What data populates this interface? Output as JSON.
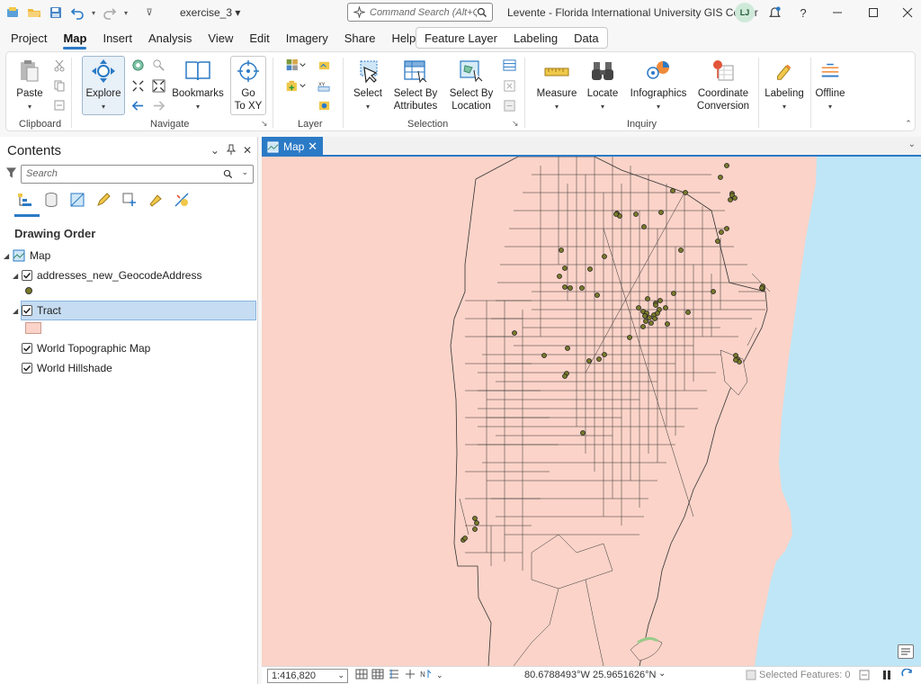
{
  "titlebar": {
    "project_name": "exercise_3 ▾",
    "command_search_placeholder": "Command Search (Alt+Q)",
    "user_info": "Levente - Florida International University GIS Center",
    "avatar_initials": "LJ"
  },
  "menu": {
    "tabs": [
      "Project",
      "Map",
      "Insert",
      "Analysis",
      "View",
      "Edit",
      "Imagery",
      "Share",
      "Help"
    ],
    "active_tab": "Map",
    "contextual_tabs": [
      "Feature Layer",
      "Labeling",
      "Data"
    ]
  },
  "ribbon": {
    "clipboard": {
      "paste": "Paste",
      "group": "Clipboard"
    },
    "navigate": {
      "explore": "Explore",
      "bookmarks": "Bookmarks",
      "goto_xy_line1": "Go",
      "goto_xy_line2": "To XY",
      "group": "Navigate"
    },
    "layer": {
      "group": "Layer"
    },
    "selection": {
      "select": "Select",
      "select_by_attr_line1": "Select By",
      "select_by_attr_line2": "Attributes",
      "select_by_loc_line1": "Select By",
      "select_by_loc_line2": "Location",
      "group": "Selection"
    },
    "inquiry": {
      "measure": "Measure",
      "locate": "Locate",
      "infographics": "Infographics",
      "coord_conv_line1": "Coordinate",
      "coord_conv_line2": "Conversion",
      "group": "Inquiry"
    },
    "labeling": {
      "labeling": "Labeling"
    },
    "offline": {
      "offline": "Offline"
    }
  },
  "contents": {
    "title": "Contents",
    "search_placeholder": "Search",
    "section": "Drawing Order",
    "layers": {
      "map": "Map",
      "geocode": "addresses_new_GeocodeAddress",
      "tract": "Tract",
      "topo": "World Topographic Map",
      "hillshade": "World Hillshade"
    }
  },
  "mapview": {
    "tab_label": "Map",
    "scale": "1:416,820",
    "coordinates": "80.6788493°W 25.9651626°N",
    "selected_features": "Selected Features: 0"
  },
  "colors": {
    "accent": "#2b7ac6",
    "tract_fill": "#fbd3c8",
    "water": "#bfe6f7",
    "point_fill": "#7a7a2a",
    "selection_highlight": "#c5dcf2"
  }
}
